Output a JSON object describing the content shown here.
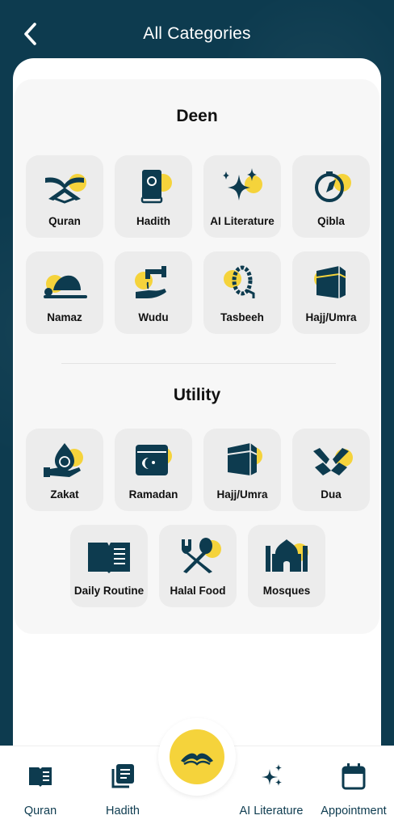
{
  "header": {
    "title": "All Categories",
    "back_icon": "chevron-left-icon"
  },
  "colors": {
    "primary": "#0d3b4f",
    "accent": "#f5d33b",
    "tile": "#ececec",
    "panel": "#f7f7f7"
  },
  "sections": {
    "deen": {
      "title": "Deen",
      "items": [
        {
          "label": "Quran",
          "icon": "quran-stand-icon"
        },
        {
          "label": "Hadith",
          "icon": "hadith-book-icon"
        },
        {
          "label": "AI Literature",
          "icon": "sparkles-icon"
        },
        {
          "label": "Qibla",
          "icon": "compass-icon"
        },
        {
          "label": "Namaz",
          "icon": "prostration-icon"
        },
        {
          "label": "Wudu",
          "icon": "water-tap-hand-icon"
        },
        {
          "label": "Tasbeeh",
          "icon": "prayer-beads-icon"
        },
        {
          "label": "Hajj/Umra",
          "icon": "kaaba-icon"
        }
      ]
    },
    "utility": {
      "title": "Utility",
      "items": [
        {
          "label": "Zakat",
          "icon": "charity-coin-icon"
        },
        {
          "label": "Ramadan",
          "icon": "calendar-crescent-icon"
        },
        {
          "label": "Hajj/Umra",
          "icon": "kaaba-icon"
        },
        {
          "label": "Dua",
          "icon": "praying-hands-icon"
        },
        {
          "label": "Daily Routine",
          "icon": "open-book-icon"
        },
        {
          "label": "Halal Food",
          "icon": "fork-spoon-icon"
        },
        {
          "label": "Mosques",
          "icon": "mosque-icon"
        }
      ]
    }
  },
  "bottom_nav": {
    "items": [
      {
        "label": "Quran",
        "icon": "book-icon"
      },
      {
        "label": "Hadith",
        "icon": "pages-icon"
      },
      {
        "label": "AI Literature",
        "icon": "sparkles-icon"
      },
      {
        "label": "Appointment",
        "icon": "calendar-icon"
      }
    ],
    "center_icon": "quran-stand-icon"
  }
}
